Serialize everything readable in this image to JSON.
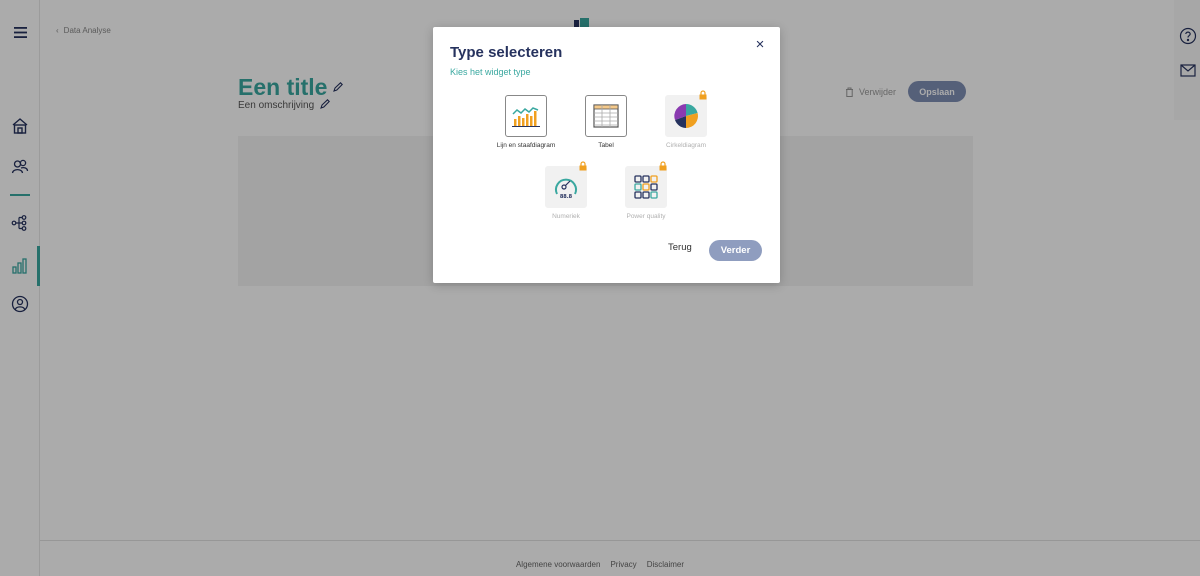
{
  "breadcrumb": {
    "back_icon": "chevron-left-icon",
    "label": "Data Analyse"
  },
  "page": {
    "title": "Een title",
    "description": "Een omschrijving",
    "delete_label": "Verwijder",
    "save_label": "Opslaan"
  },
  "sidebar": {
    "items": [
      {
        "icon": "menu-icon"
      },
      {
        "icon": "home-icon"
      },
      {
        "icon": "users-icon"
      },
      {
        "icon": "hierarchy-icon"
      },
      {
        "icon": "bar-chart-icon",
        "active": true
      },
      {
        "icon": "user-circle-icon"
      }
    ]
  },
  "right_rail": {
    "items": [
      {
        "icon": "help-icon"
      },
      {
        "icon": "mail-icon"
      }
    ]
  },
  "footer": {
    "links": [
      "Algemene voorwaarden",
      "Privacy",
      "Disclaimer"
    ]
  },
  "modal": {
    "title": "Type selecteren",
    "subtitle": "Kies het widget type",
    "close_icon": "close-icon",
    "widgets": [
      {
        "label": "Lijn en staafdiagram",
        "icon": "line-bar-chart-icon",
        "locked": false
      },
      {
        "label": "Tabel",
        "icon": "table-icon",
        "locked": false
      },
      {
        "label": "Cirkeldiagram",
        "icon": "pie-chart-icon",
        "locked": true
      },
      {
        "label": "Numeriek",
        "icon": "gauge-icon",
        "locked": true,
        "value_text": "88.8"
      },
      {
        "label": "Power quality",
        "icon": "power-quality-grid-icon",
        "locked": true
      }
    ],
    "back_label": "Terug",
    "next_label": "Verder"
  },
  "colors": {
    "accent": "#3aa8a0",
    "navy": "#26325e",
    "button": "#8f9dbf",
    "overlay": "rgba(0,0,0,0.33)"
  }
}
